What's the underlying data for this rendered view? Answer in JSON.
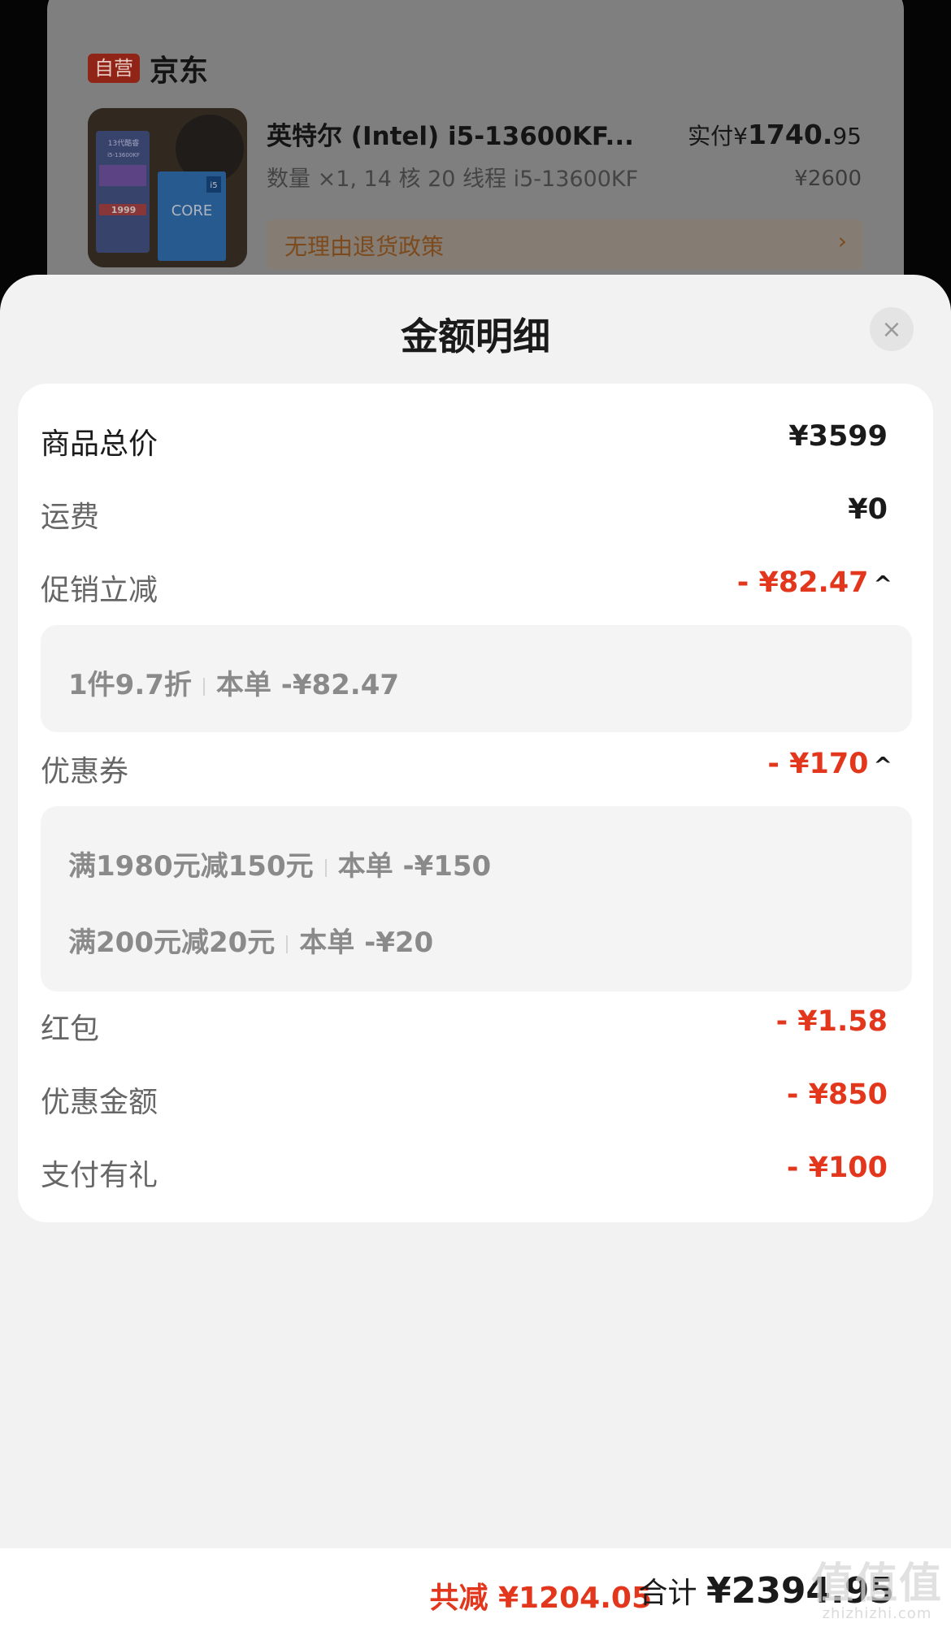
{
  "background": {
    "store_badge": "自营",
    "store_name": "京东",
    "product": {
      "title": "英特尔 (Intel) i5-13600KF...",
      "subtitle": "数量 ×1, 14 核 20 线程 i5-13600KF",
      "paid_label": "实付¥",
      "paid_int": "1740.",
      "paid_dec": "95",
      "original_price": "¥2600",
      "policy": "无理由退货政策",
      "policy_chevron": "›",
      "thumb_texts": [
        "13代酷睿",
        "i5-13600KF",
        "1999",
        "CORE",
        "i5"
      ]
    }
  },
  "sheet": {
    "title": "金额明细",
    "close_glyph": "×",
    "rows": [
      {
        "label": "商品总价",
        "value": "¥3599"
      },
      {
        "label": "运费",
        "value": "¥0"
      },
      {
        "label": "促销立减",
        "value": "- ¥82.47"
      },
      {
        "label": "优惠券",
        "value": "- ¥170"
      },
      {
        "label": "红包",
        "value": "- ¥1.58"
      },
      {
        "label": "优惠金额",
        "value": "- ¥850"
      },
      {
        "label": "支付有礼",
        "value": "- ¥100"
      }
    ],
    "promo_details": [
      {
        "name": "1件9.7折",
        "amount": "本单 -¥82.47"
      }
    ],
    "coupon_details": [
      {
        "name": "满1980元减150元",
        "amount": "本单 -¥150"
      },
      {
        "name": "满200元减20元",
        "amount": "本单 -¥20"
      }
    ],
    "chevron": "^"
  },
  "bottom": {
    "reduce_text": "共减 ¥1204.05",
    "sum_label": "合计 ",
    "sum_amount": "¥2394.95"
  },
  "watermark": {
    "glyphs": "值值值",
    "url": "zhizhizhi.com"
  },
  "colors": {
    "accent_red": "#e2371d",
    "sheet_bg": "#f2f2f2",
    "card_bg": "#ffffff"
  }
}
